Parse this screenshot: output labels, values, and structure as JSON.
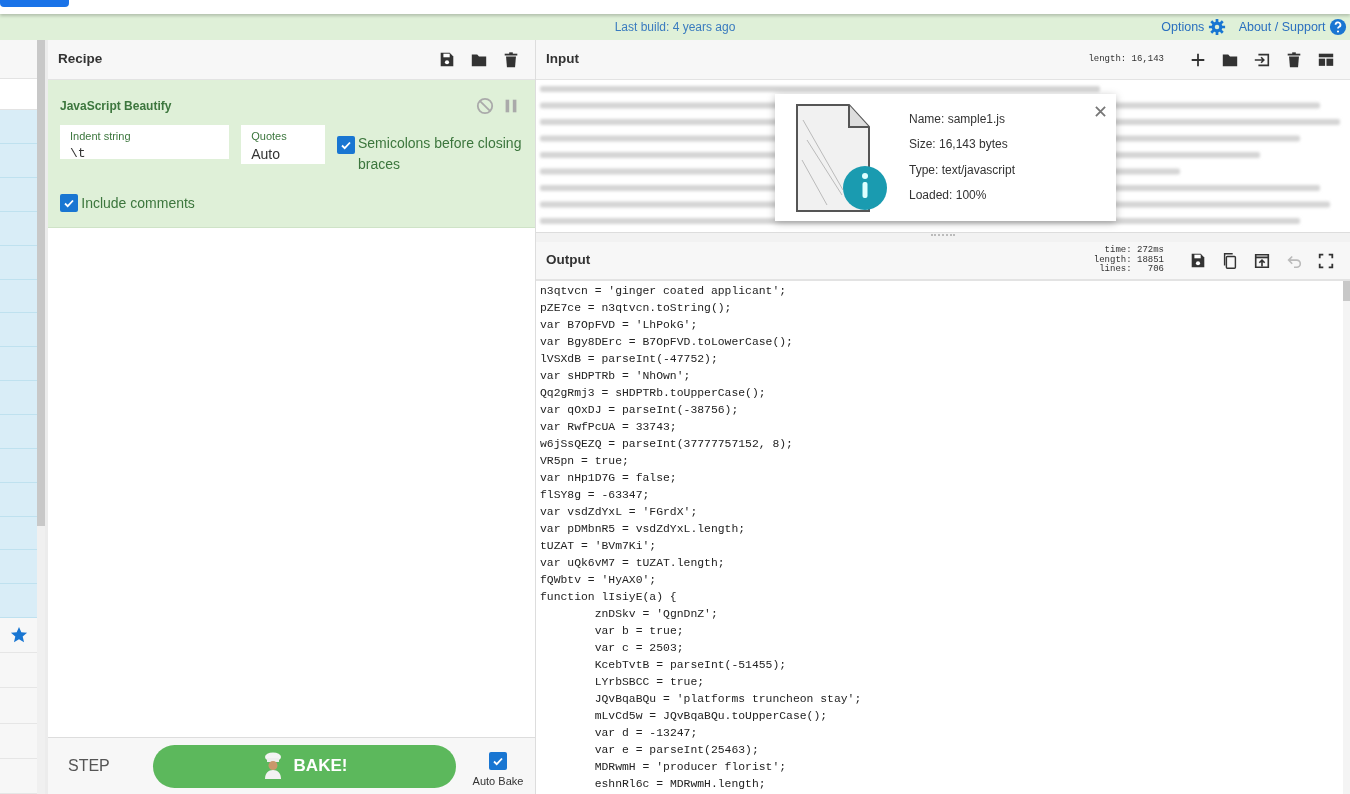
{
  "banner": {
    "text": "Last build: 4 years ago",
    "links": [
      {
        "label": "Options",
        "kind": "gear"
      },
      {
        "label": "About / Support",
        "kind": "help"
      }
    ]
  },
  "sidebar": {
    "items": [
      {
        "kind": "row",
        "highlighted": true
      },
      {
        "kind": "row",
        "highlighted": true
      },
      {
        "kind": "row",
        "highlighted": true
      },
      {
        "kind": "row",
        "highlighted": true
      },
      {
        "kind": "row",
        "highlighted": true
      },
      {
        "kind": "row",
        "highlighted": true
      },
      {
        "kind": "row",
        "highlighted": true
      },
      {
        "kind": "row",
        "highlighted": true
      },
      {
        "kind": "row",
        "highlighted": true
      },
      {
        "kind": "row",
        "highlighted": true
      },
      {
        "kind": "row",
        "highlighted": true
      },
      {
        "kind": "row",
        "highlighted": true
      },
      {
        "kind": "row",
        "highlighted": true
      },
      {
        "kind": "row",
        "highlighted": true
      },
      {
        "kind": "row",
        "highlighted": true
      },
      {
        "kind": "favourites",
        "highlighted": false
      },
      {
        "kind": "row",
        "highlighted": false
      },
      {
        "kind": "row",
        "highlighted": false
      },
      {
        "kind": "row",
        "highlighted": false
      },
      {
        "kind": "row",
        "highlighted": false
      }
    ]
  },
  "recipe": {
    "title": "Recipe",
    "buttons": [
      {
        "kind": "save"
      },
      {
        "kind": "folder"
      },
      {
        "kind": "trash"
      }
    ],
    "operation": {
      "title": "JavaScript Beautify",
      "disabled": false,
      "paused": false,
      "fields": [
        {
          "label": "Indent string",
          "value": "\\t",
          "kind": "text"
        },
        {
          "label": "Quotes",
          "value": "Auto",
          "kind": "select"
        }
      ],
      "checkboxes": [
        {
          "label": "Semicolons before closing braces",
          "checked": true
        },
        {
          "label": "Include comments",
          "checked": true
        }
      ]
    },
    "step": "STEP",
    "bake": "BAKE!",
    "auto_bake": {
      "label": "Auto Bake",
      "checked": true
    }
  },
  "input": {
    "title": "Input",
    "stats": [
      "length: 16,143"
    ],
    "buttons": [
      {
        "kind": "plus",
        "disabled": false
      },
      {
        "kind": "folder",
        "disabled": false
      },
      {
        "kind": "import",
        "disabled": false
      },
      {
        "kind": "trash",
        "disabled": false
      },
      {
        "kind": "layout",
        "disabled": false
      }
    ],
    "file": {
      "name": "Name: sample1.js",
      "size": "Size: 16,143 bytes",
      "type": "Type: text/javascript",
      "loaded": "Loaded: 100%"
    }
  },
  "output": {
    "title": "Output",
    "stats": [
      "time: 272ms",
      "length: 18851",
      "lines:   706"
    ],
    "buttons": [
      {
        "kind": "save",
        "disabled": false
      },
      {
        "kind": "copy",
        "disabled": false
      },
      {
        "kind": "open",
        "disabled": false
      },
      {
        "kind": "undo",
        "disabled": true
      },
      {
        "kind": "fullscreen",
        "disabled": false
      }
    ],
    "lines": [
      "n3qtvcn = 'ginger coated applicant';",
      "pZE7ce = n3qtvcn.toString();",
      "var B7OpFVD = 'LhPokG';",
      "var Bgy8DErc = B7OpFVD.toLowerCase();",
      "lVSXdB = parseInt(-47752);",
      "var sHDPTRb = 'NhOwn';",
      "Qq2gRmj3 = sHDPTRb.toUpperCase();",
      "var qOxDJ = parseInt(-38756);",
      "var RwfPcUA = 33743;",
      "w6jSsQEZQ = parseInt(37777757152, 8);",
      "VR5pn = true;",
      "var nHp1D7G = false;",
      "flSY8g = -63347;",
      "var vsdZdYxL = 'FGrdX';",
      "var pDMbnR5 = vsdZdYxL.length;",
      "tUZAT = 'BVm7Ki';",
      "var uQk6vM7 = tUZAT.length;",
      "fQWbtv = 'HyAX0';",
      "function lIsiyE(a) {",
      "\tznDSkv = 'QgnDnZ';",
      "\tvar b = true;",
      "\tvar c = 2503;",
      "\tKcebTvtB = parseInt(-51455);",
      "\tLYrbSBCC = true;",
      "\tJQvBqaBQu = 'platforms truncheon stay';",
      "\tmLvCd5w = JQvBqaBQu.toUpperCase();",
      "\tvar d = -13247;",
      "\tvar e = parseInt(25463);",
      "\tMDRwmH = 'producer florist';",
      "\teshnRl6c = MDRwmH.length;"
    ]
  }
}
